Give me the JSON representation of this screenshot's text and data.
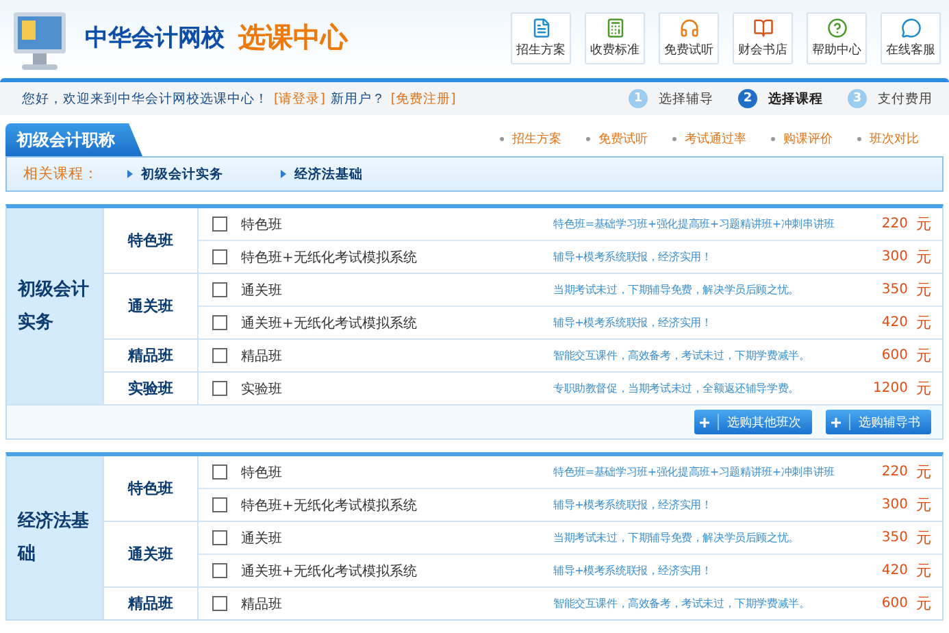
{
  "header": {
    "brand": "中华会计网校",
    "title": "选课中心",
    "nav": [
      {
        "label": "招生方案",
        "kind": "plan"
      },
      {
        "label": "收费标准",
        "kind": "fee"
      },
      {
        "label": "免费试听",
        "kind": "listen"
      },
      {
        "label": "财会书店",
        "kind": "book"
      },
      {
        "label": "帮助中心",
        "kind": "help"
      },
      {
        "label": "在线客服",
        "kind": "chat"
      }
    ]
  },
  "welcome": {
    "greeting": "您好，欢迎来到中华会计网校选课中心！",
    "login": "[请登录]",
    "new_user": "新用户？",
    "register": "[免费注册]",
    "steps": [
      {
        "number": "1",
        "label": "选择辅导",
        "selected": false
      },
      {
        "number": "2",
        "label": "选择课程",
        "selected": true
      },
      {
        "number": "3",
        "label": "支付费用",
        "selected": false
      }
    ]
  },
  "section": {
    "title": "初级会计职称",
    "links": [
      "招生方案",
      "免费试听",
      "考试通过率",
      "购课评价",
      "班次对比"
    ],
    "related_label": "相关课程：",
    "related": [
      "初级会计实务",
      "经济法基础"
    ]
  },
  "courses": [
    {
      "name": "初级会计实务",
      "groups": [
        {
          "name": "特色班",
          "options": [
            {
              "label": "特色班",
              "checked": false,
              "desc": "特色班=基础学习班+强化提高班+习题精讲班+冲刺串讲班",
              "price": "220",
              "unit": "元"
            },
            {
              "label": "特色班+无纸化考试模拟系统",
              "checked": false,
              "desc": "辅导+模考系统联报，经济实用！",
              "price": "300",
              "unit": "元"
            }
          ]
        },
        {
          "name": "通关班",
          "options": [
            {
              "label": "通关班",
              "checked": false,
              "desc": "当期考试未过，下期辅导免费，解决学员后顾之忧。",
              "price": "350",
              "unit": "元"
            },
            {
              "label": "通关班+无纸化考试模拟系统",
              "checked": false,
              "desc": "辅导+模考系统联报，经济实用！",
              "price": "420",
              "unit": "元"
            }
          ]
        },
        {
          "name": "精品班",
          "options": [
            {
              "label": "精品班",
              "checked": false,
              "desc": "智能交互课件，高效备考，考试未过，下期学费减半。",
              "price": "600",
              "unit": "元"
            }
          ]
        },
        {
          "name": "实验班",
          "options": [
            {
              "label": "实验班",
              "checked": false,
              "desc": "专职助教督促，当期考试未过，全额返还辅导学费。",
              "price": "1200",
              "unit": "元"
            }
          ]
        }
      ],
      "buttons": [
        "选购其他班次",
        "选购辅导书"
      ]
    },
    {
      "name": "经济法基础",
      "groups": [
        {
          "name": "特色班",
          "options": [
            {
              "label": "特色班",
              "checked": false,
              "desc": "特色班=基础学习班+强化提高班+习题精讲班+冲刺串讲班",
              "price": "220",
              "unit": "元"
            },
            {
              "label": "特色班+无纸化考试模拟系统",
              "checked": false,
              "desc": "辅导+模考系统联报，经济实用！",
              "price": "300",
              "unit": "元"
            }
          ]
        },
        {
          "name": "通关班",
          "options": [
            {
              "label": "通关班",
              "checked": false,
              "desc": "当期考试未过，下期辅导免费，解决学员后顾之忧。",
              "price": "350",
              "unit": "元"
            },
            {
              "label": "通关班+无纸化考试模拟系统",
              "checked": false,
              "desc": "辅导+模考系统联报，经济实用！",
              "price": "420",
              "unit": "元"
            }
          ]
        },
        {
          "name": "精品班",
          "options": [
            {
              "label": "精品班",
              "checked": false,
              "desc": "智能交互课件，高效备考，考试未过，下期学费减半。",
              "price": "600",
              "unit": "元"
            }
          ]
        }
      ]
    }
  ]
}
